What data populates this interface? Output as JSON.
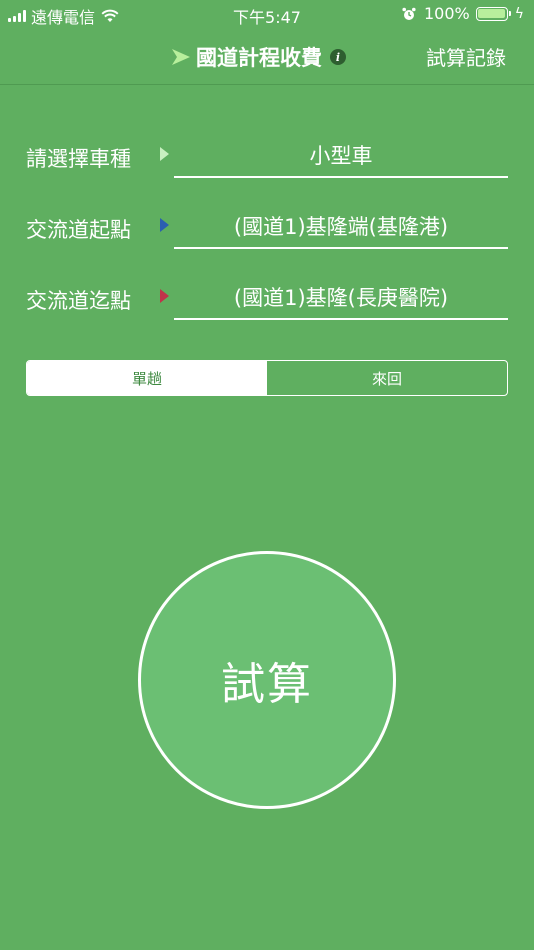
{
  "status_bar": {
    "carrier": "遠傳電信",
    "time": "下午5:47",
    "battery": "100%",
    "battery_level": 1.0
  },
  "nav": {
    "title": "國道計程收費",
    "right_button": "試算記錄",
    "icons": [
      "flag-icon",
      "info-icon"
    ]
  },
  "form": {
    "vehicle": {
      "label": "請選擇車種",
      "value": "小型車",
      "arrow_color": "#c8f0c0"
    },
    "start": {
      "label": "交流道起點",
      "value": "(國道1)基隆端(基隆港)",
      "arrow_color": "#2b5fb0"
    },
    "end": {
      "label": "交流道迄點",
      "value": "(國道1)基隆(長庚醫院)",
      "arrow_color": "#c0334a"
    }
  },
  "trip": {
    "options": [
      "單趟",
      "來回"
    ],
    "selected": "單趟"
  },
  "calculate_button": "試算",
  "colors": {
    "background": "#5faf60",
    "button": "#6bbf73",
    "active_segment_text": "#3f8a41"
  }
}
